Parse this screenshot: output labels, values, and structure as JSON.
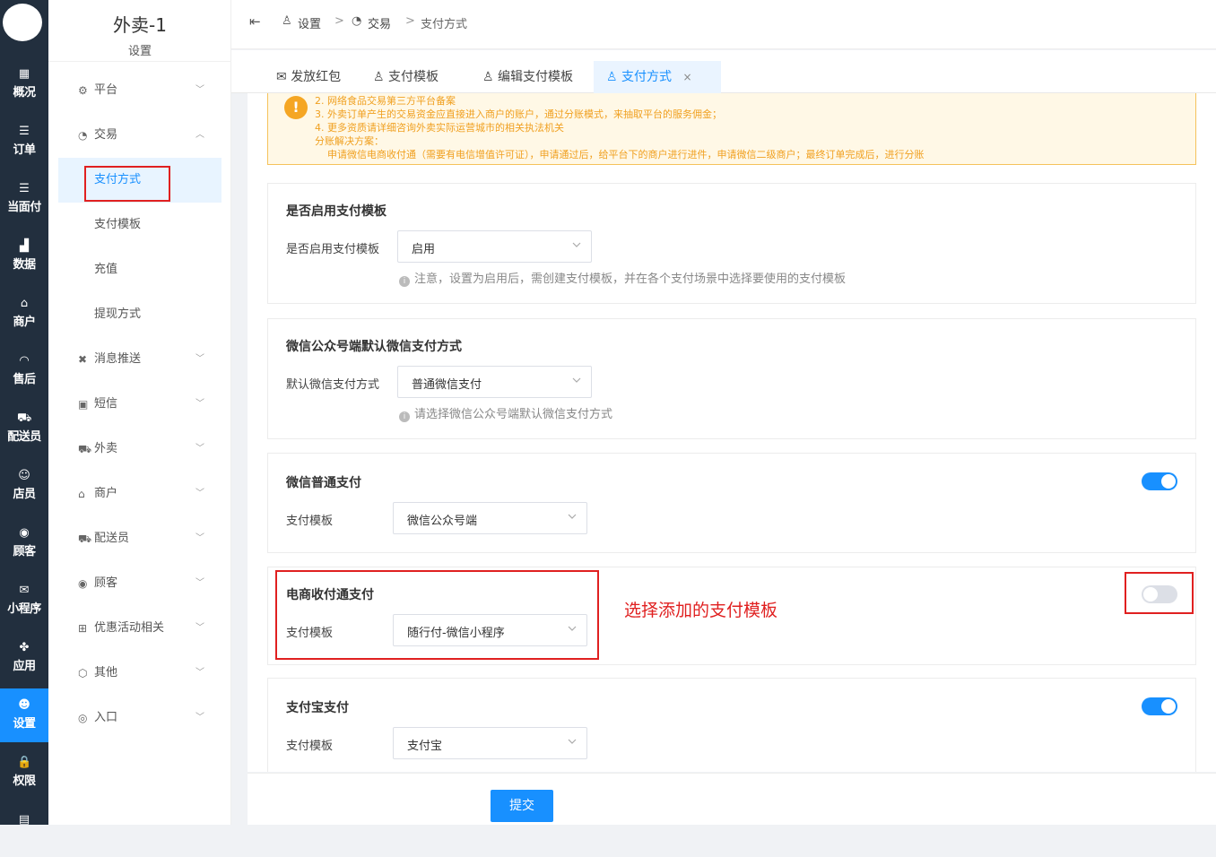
{
  "rail": {
    "items": [
      {
        "icon": "grid-icon",
        "glyph": "▦",
        "label": "概况"
      },
      {
        "icon": "list-icon",
        "glyph": "☰",
        "label": "订单"
      },
      {
        "icon": "list-icon",
        "glyph": "☰",
        "label": "当面付"
      },
      {
        "icon": "bar-chart-icon",
        "glyph": "▟",
        "label": "数据"
      },
      {
        "icon": "store-icon",
        "glyph": "⌂",
        "label": "商户"
      },
      {
        "icon": "headset-icon",
        "glyph": "◠",
        "label": "售后"
      },
      {
        "icon": "scooter-icon",
        "glyph": "⛟",
        "label": "配送员"
      },
      {
        "icon": "users-icon",
        "glyph": "☺",
        "label": "店员"
      },
      {
        "icon": "user-circle-icon",
        "glyph": "◉",
        "label": "顾客"
      },
      {
        "icon": "wechat-icon",
        "glyph": "✉",
        "label": "小程序"
      },
      {
        "icon": "apps-icon",
        "glyph": "✤",
        "label": "应用"
      },
      {
        "icon": "user-gear-icon",
        "glyph": "☻",
        "label": "设置"
      },
      {
        "icon": "lock-icon",
        "glyph": "🔒",
        "label": "权限"
      },
      {
        "icon": "chart-icon",
        "glyph": "▤",
        "label": ""
      }
    ]
  },
  "sidebar": {
    "title": "外卖-1",
    "caption": "设置",
    "menu": [
      {
        "icon": "gear-icon",
        "glyph": "⚙",
        "label": "平台",
        "arrow": "﹀"
      },
      {
        "icon": "exchange-icon",
        "glyph": "◔",
        "label": "交易",
        "arrow": "︿"
      },
      {
        "icon": "bell-off-icon",
        "glyph": "✖",
        "label": "消息推送",
        "arrow": "﹀"
      },
      {
        "icon": "sms-icon",
        "glyph": "▣",
        "label": "短信",
        "arrow": "﹀"
      },
      {
        "icon": "scooter-icon",
        "glyph": "⛟",
        "label": "外卖",
        "arrow": "﹀"
      },
      {
        "icon": "store-icon",
        "glyph": "⌂",
        "label": "商户",
        "arrow": "﹀"
      },
      {
        "icon": "rider-icon",
        "glyph": "⛟",
        "label": "配送员",
        "arrow": "﹀"
      },
      {
        "icon": "user-circle-icon",
        "glyph": "◉",
        "label": "顾客",
        "arrow": "﹀"
      },
      {
        "icon": "gift-icon",
        "glyph": "⊞",
        "label": "优惠活动相关",
        "arrow": "﹀"
      },
      {
        "icon": "hexagon-icon",
        "glyph": "⬡",
        "label": "其他",
        "arrow": "﹀"
      },
      {
        "icon": "compass-icon",
        "glyph": "◎",
        "label": "入口",
        "arrow": "﹀"
      }
    ],
    "children": [
      "支付方式",
      "支付模板",
      "充值",
      "提现方式"
    ]
  },
  "header": {
    "collapse_glyph": "⇤",
    "crumbs": [
      "设置",
      "交易",
      "支付方式"
    ],
    "sep": ">"
  },
  "tabs": [
    {
      "icon": "envelope-icon",
      "glyph": "✉",
      "label": "发放红包"
    },
    {
      "icon": "user-icon",
      "glyph": "♙",
      "label": "支付模板"
    },
    {
      "icon": "user-icon",
      "glyph": "♙",
      "label": "编辑支付模板"
    },
    {
      "icon": "user-icon",
      "glyph": "♙",
      "label": "支付方式",
      "close": "×"
    }
  ],
  "notice": {
    "lines": [
      "2. 网络食品交易第三方平台备案",
      "3. 外卖订单产生的交易资金应直接进入商户的账户，通过分账模式，来抽取平台的服务佣金；",
      "4. 更多资质请详细咨询外卖实际运营城市的相关执法机关",
      "分账解决方案：",
      "    申请微信电商收付通（需要有电信增值许可证），申请通过后，给平台下的商户进行进件，申请微信二级商户；最终订单完成后，进行分账"
    ]
  },
  "cards": {
    "template_toggle": {
      "title": "是否启用支付模板",
      "label": "是否启用支付模板",
      "value": "启用",
      "hint": "注意，设置为启用后，需创建支付模板，并在各个支付场景中选择要使用的支付模板"
    },
    "wechat_default": {
      "title": "微信公众号端默认微信支付方式",
      "label": "默认微信支付方式",
      "value": "普通微信支付",
      "hint": "请选择微信公众号端默认微信支付方式"
    },
    "wechat_normal": {
      "title": "微信普通支付",
      "label": "支付模板",
      "value": "微信公众号端",
      "enabled": true
    },
    "ecommerce": {
      "title": "电商收付通支付",
      "label": "支付模板",
      "value": "随行付-微信小程序",
      "enabled": false
    },
    "alipay": {
      "title": "支付宝支付",
      "label": "支付模板",
      "value": "支付宝",
      "enabled": true
    }
  },
  "annotation": "选择添加的支付模板",
  "footer": {
    "submit": "提交"
  },
  "colors": {
    "accent": "#1890ff",
    "rail": "#222f3e",
    "annotation": "#e02020",
    "notice_text": "#f0a020"
  }
}
